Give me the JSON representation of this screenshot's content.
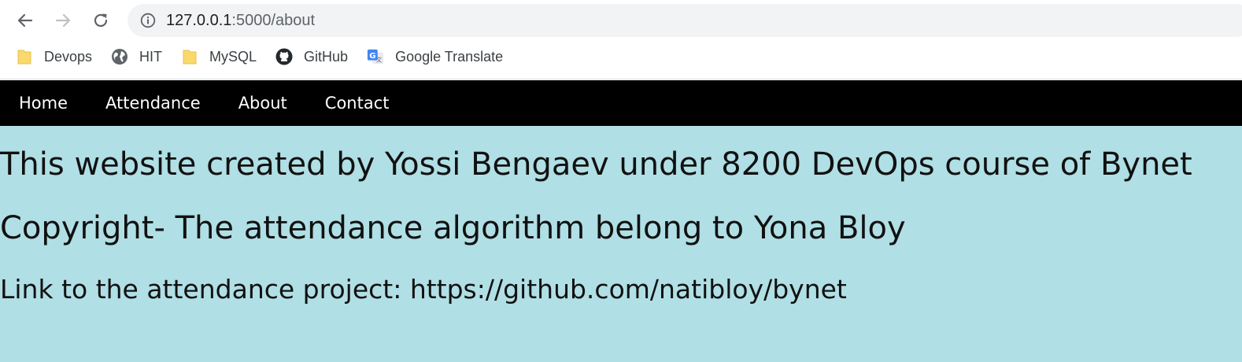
{
  "browser": {
    "url_host": "127.0.0.1",
    "url_path": ":5000/about",
    "bookmarks": [
      {
        "label": "Devops",
        "icon": "folder-icon"
      },
      {
        "label": "HIT",
        "icon": "globe-icon"
      },
      {
        "label": "MySQL",
        "icon": "folder-icon"
      },
      {
        "label": "GitHub",
        "icon": "github-icon"
      },
      {
        "label": "Google Translate",
        "icon": "google-translate-icon"
      }
    ]
  },
  "nav": {
    "items": [
      {
        "label": "Home"
      },
      {
        "label": "Attendance"
      },
      {
        "label": "About"
      },
      {
        "label": "Contact"
      }
    ]
  },
  "content": {
    "heading": "This website created by Yossi Bengaev under 8200 DevOps course of Bynet",
    "copyright": "Copyright- The attendance algorithm belong to Yona Bloy",
    "link_text": "Link to the attendance project: https://github.com/natibloy/bynet"
  },
  "colors": {
    "page_background": "#b0dfe5",
    "nav_background": "#000000",
    "nav_text": "#ffffff",
    "omnibox_background": "#f1f3f4"
  }
}
